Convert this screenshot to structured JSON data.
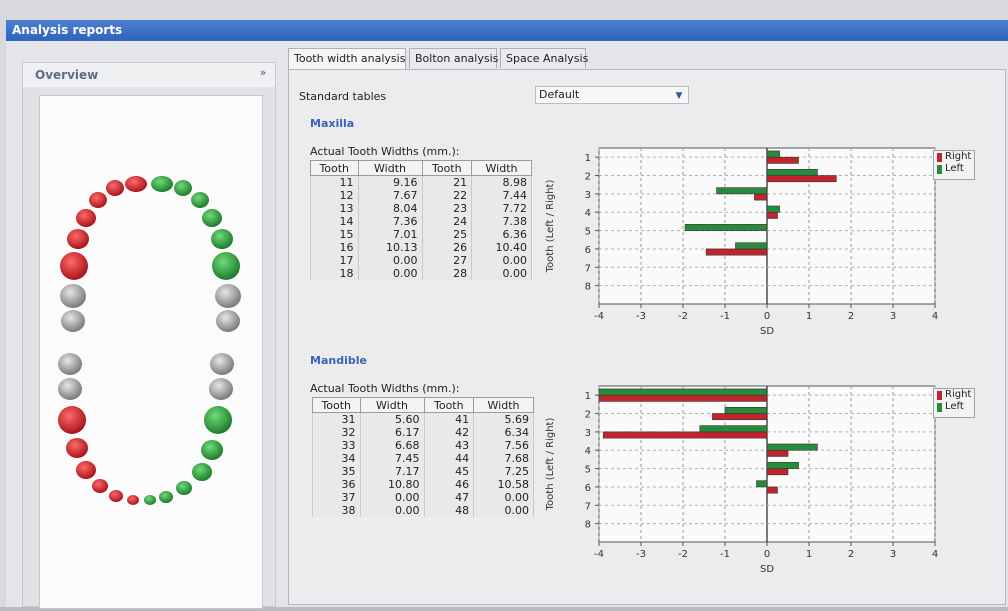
{
  "window_title": "Analysis reports",
  "overview": {
    "title": "Overview",
    "collapse_glyph": "»"
  },
  "tabs": [
    {
      "label": "Tooth width analysis",
      "active": true
    },
    {
      "label": "Bolton analysis",
      "active": false
    },
    {
      "label": "Space Analysis",
      "active": false
    }
  ],
  "standard_tables": {
    "label": "Standard tables",
    "value": "Default"
  },
  "colors": {
    "right": "#c0242c",
    "left": "#2a8a3c",
    "accent": "#3a63b8"
  },
  "maxilla": {
    "title": "Maxilla",
    "table_caption": "Actual Tooth Widths (mm.):",
    "headers": [
      "Tooth",
      "Width",
      "Tooth",
      "Width"
    ],
    "rows": [
      [
        "11",
        "9.16",
        "21",
        "8.98"
      ],
      [
        "12",
        "7.67",
        "22",
        "7.44"
      ],
      [
        "13",
        "8.04",
        "23",
        "7.72"
      ],
      [
        "14",
        "7.36",
        "24",
        "7.38"
      ],
      [
        "15",
        "7.01",
        "25",
        "6.36"
      ],
      [
        "16",
        "10.13",
        "26",
        "10.40"
      ],
      [
        "17",
        "0.00",
        "27",
        "0.00"
      ],
      [
        "18",
        "0.00",
        "28",
        "0.00"
      ]
    ]
  },
  "mandible": {
    "title": "Mandible",
    "table_caption": "Actual Tooth Widths (mm.):",
    "headers": [
      "Tooth",
      "Width",
      "Tooth",
      "Width"
    ],
    "rows": [
      [
        "31",
        "5.60",
        "41",
        "5.69"
      ],
      [
        "32",
        "6.17",
        "42",
        "6.34"
      ],
      [
        "33",
        "6.68",
        "43",
        "7.56"
      ],
      [
        "34",
        "7.45",
        "44",
        "7.68"
      ],
      [
        "35",
        "7.17",
        "45",
        "7.25"
      ],
      [
        "36",
        "10.80",
        "46",
        "10.58"
      ],
      [
        "37",
        "0.00",
        "47",
        "0.00"
      ],
      [
        "38",
        "0.00",
        "48",
        "0.00"
      ]
    ]
  },
  "chart_data": [
    {
      "type": "bar",
      "orientation": "horizontal",
      "categories": [
        "1",
        "2",
        "3",
        "4",
        "5",
        "6",
        "7",
        "8"
      ],
      "xlabel": "SD",
      "ylabel": "Tooth (Left / Right)",
      "xlim": [
        -4,
        4
      ],
      "xticks": [
        "-4",
        "-3",
        "-2",
        "-1",
        "0",
        "1",
        "2",
        "3",
        "4"
      ],
      "grid": true,
      "legend_position": "top-right",
      "series": [
        {
          "name": "Right",
          "values": [
            0.75,
            1.65,
            -0.3,
            0.25,
            0.0,
            -1.45,
            0,
            0
          ]
        },
        {
          "name": "Left",
          "values": [
            0.3,
            1.2,
            -1.2,
            0.3,
            -1.95,
            -0.75,
            0,
            0
          ]
        }
      ]
    },
    {
      "type": "bar",
      "orientation": "horizontal",
      "categories": [
        "1",
        "2",
        "3",
        "4",
        "5",
        "6",
        "7",
        "8"
      ],
      "xlabel": "SD",
      "ylabel": "Tooth (Left / Right)",
      "xlim": [
        -4,
        4
      ],
      "xticks": [
        "-4",
        "-3",
        "-2",
        "-1",
        "0",
        "1",
        "2",
        "3",
        "4"
      ],
      "grid": true,
      "legend_position": "top-right",
      "series": [
        {
          "name": "Right",
          "values": [
            -4.0,
            -1.3,
            -3.9,
            0.5,
            0.5,
            0.25,
            0,
            0
          ]
        },
        {
          "name": "Left",
          "values": [
            -4.0,
            -1.0,
            -1.6,
            1.2,
            0.75,
            -0.25,
            0,
            0
          ]
        }
      ]
    }
  ]
}
